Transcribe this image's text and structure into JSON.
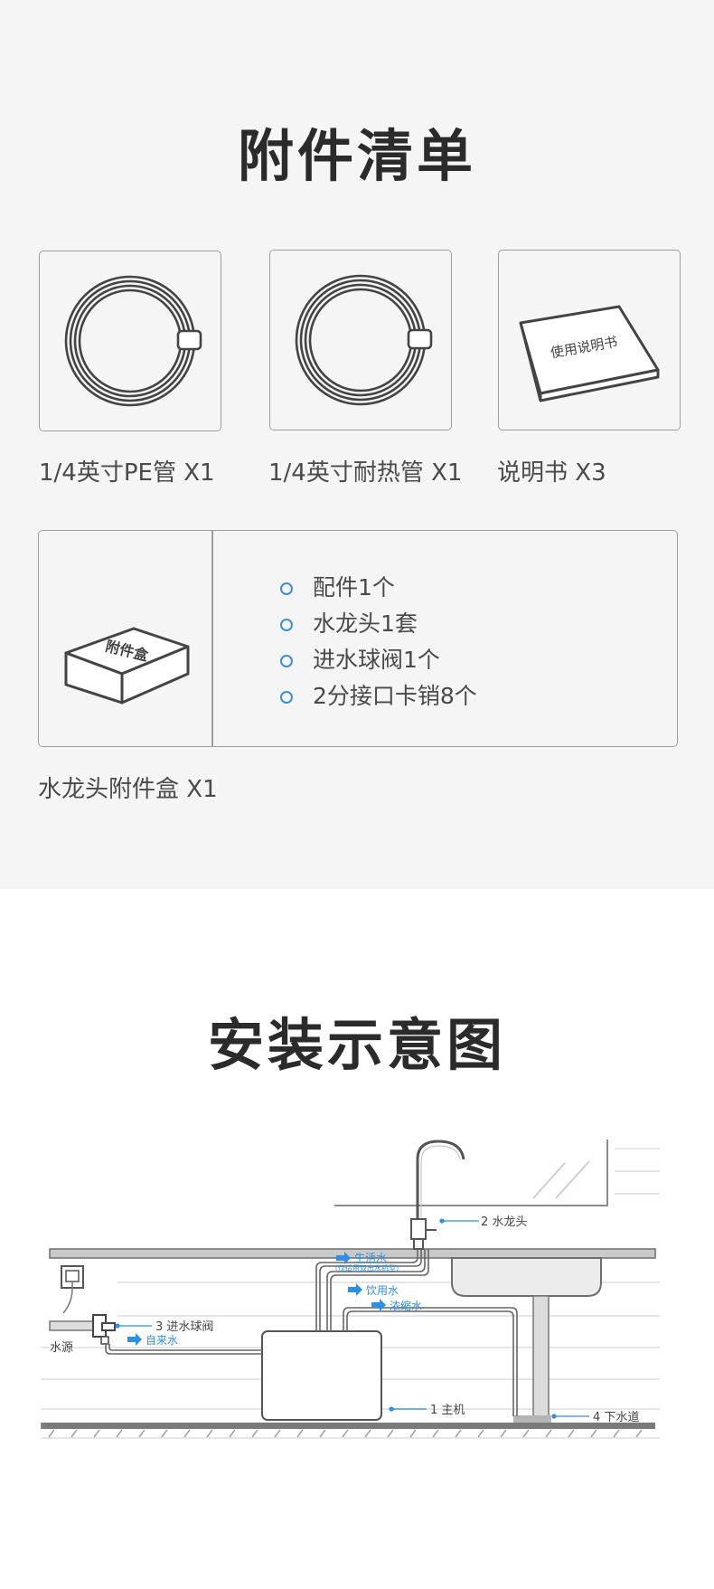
{
  "accessories": {
    "title": "附件清单",
    "items": [
      {
        "label": "1/4英寸PE管 X1"
      },
      {
        "label": "1/4英寸耐热管 X1"
      },
      {
        "label": "说明书 X3"
      }
    ],
    "manual_cover_text": "使用说明书",
    "box_cover_text": "附件盒",
    "box_contents": [
      "配件1个",
      "水龙头1套",
      "进水球阀1个",
      "2分接口卡销8个"
    ],
    "box_label": "水龙头附件盒 X1"
  },
  "install": {
    "title": "安装示意图",
    "labels": {
      "faucet": "2 水龙头",
      "ball_valve": "3 进水球阀",
      "water_source": "水源",
      "main_unit": "1 主机",
      "drain": "4 下水道",
      "domestic_water": "生活水",
      "domestic_note": "（仅适用双出水机型）",
      "drinking_water": "饮用水",
      "concentrate": "浓缩水",
      "tap_water": "自来水"
    },
    "accent_color": "#2f8fe0"
  }
}
